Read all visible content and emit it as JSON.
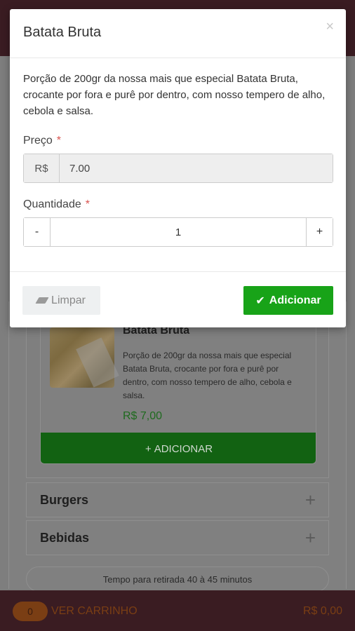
{
  "modal": {
    "title": "Batata Bruta",
    "close_glyph": "×",
    "description": "Porção de 200gr da nossa mais que especial Batata Bruta, crocante por fora e purê por dentro, com nosso tempero de alho, cebola e salsa.",
    "price_label": "Preço",
    "required_mark": "*",
    "currency": "R$",
    "price_value": "7.00",
    "quantity_label": "Quantidade",
    "qty_minus": "-",
    "qty_value": "1",
    "qty_plus": "+",
    "clear_label": "Limpar",
    "add_label": "Adicionar",
    "add_icon": "✔"
  },
  "product": {
    "name": "Batata Bruta",
    "description": "Porção de 200gr da nossa mais que especial Batata Bruta, crocante por fora e purê por dentro, com nosso tempero de alho, cebola e salsa.",
    "price": "R$ 7,00",
    "add_label": "ADICIONAR",
    "add_icon": "+"
  },
  "categories": [
    {
      "label": "Burgers",
      "toggle": "+"
    },
    {
      "label": "Bebidas",
      "toggle": "+"
    }
  ],
  "pickup_time": "Tempo para retirada 40 à 45 minutos",
  "cart": {
    "count": "0",
    "label": "VER CARRINHO",
    "total": "R$ 0,00"
  },
  "colors": {
    "brand_dark": "#3a1c22",
    "accent_green": "#18a318",
    "cart_orange": "#e07a2a"
  }
}
